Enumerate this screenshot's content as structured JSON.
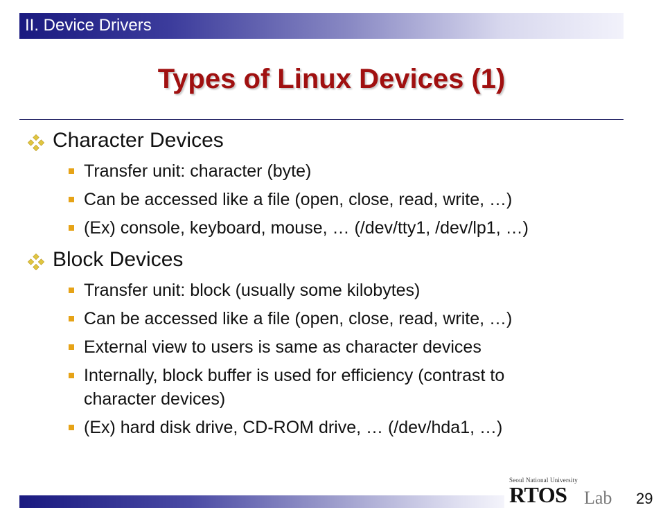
{
  "header": {
    "section_label": "II. Device Drivers"
  },
  "slide": {
    "title": "Types of Linux Devices (1)",
    "sections": [
      {
        "heading": "Character Devices",
        "bullets": [
          {
            "text": "Transfer unit: character (byte)"
          },
          {
            "text": "Can be accessed like a file (open, close, read, write, …)"
          },
          {
            "text": "(Ex) console, keyboard, mouse, … (/dev/tty1, /dev/lp1, …)"
          }
        ]
      },
      {
        "heading": "Block Devices",
        "bullets": [
          {
            "text": "Transfer unit: block (usually some kilobytes)"
          },
          {
            "text": "Can be accessed like a file (open, close, read, write, …)"
          },
          {
            "text": "External view to users is same as character devices"
          },
          {
            "text": "Internally, block buffer is used for efficiency (contrast to character devices)"
          },
          {
            "text": "(Ex) hard disk drive, CD-ROM drive, … (/dev/hda1, …)"
          }
        ]
      }
    ]
  },
  "footer": {
    "logo_subtitle": "Seoul National University",
    "logo_main": "RTOS",
    "logo_lab": "Lab",
    "page_number": "29"
  },
  "colors": {
    "title": "#a01010",
    "bullet_l2": "#e6a317",
    "bullet_l1": "#d4b020",
    "header_dark": "#1a1a80"
  },
  "icons": {
    "level1_bullet": "four-diamond-icon",
    "level2_bullet": "square-bullet-icon"
  }
}
